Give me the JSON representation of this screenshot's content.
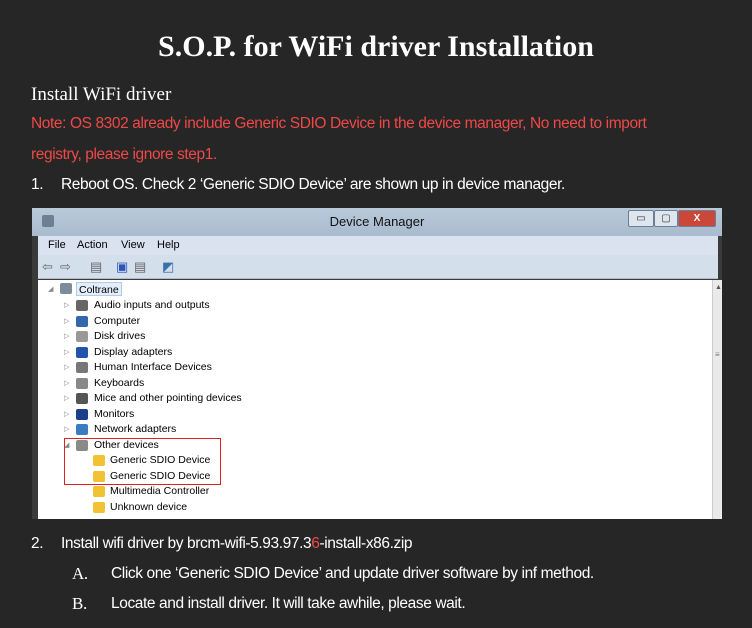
{
  "title": "S.O.P. for WiFi driver Installation",
  "subtitle": "Install WiFi driver",
  "note_line1": "Note: OS 8302 already include Generic SDIO Device in the device manager, No need to import",
  "note_line2": "registry, please ignore step1.",
  "steps": [
    {
      "num": "1.",
      "text": "Reboot OS. Check 2 ‘Generic SDIO Device’ are shown up in device manager."
    },
    {
      "num": "2.",
      "text_pre": "Install wifi driver by brcm-wifi-5.93.97.3",
      "text_red": "6",
      "text_post": "-install-x86.zip",
      "substeps": [
        {
          "letter": "A.",
          "text": "Click one ‘Generic SDIO Device’ and update driver software by inf method."
        },
        {
          "letter": "B.",
          "text": "Locate and install driver. It will take awhile, please wait."
        }
      ]
    }
  ],
  "device_manager": {
    "title": "Device Manager",
    "menu": [
      "File",
      "Action",
      "View",
      "Help"
    ],
    "root": "Coltrane",
    "categories": [
      "Audio inputs and outputs",
      "Computer",
      "Disk drives",
      "Display adapters",
      "Human Interface Devices",
      "Keyboards",
      "Mice and other pointing devices",
      "Monitors",
      "Network adapters",
      "Other devices"
    ],
    "other_devices": [
      "Generic SDIO Device",
      "Generic SDIO Device",
      "Multimedia Controller",
      "Unknown device"
    ]
  },
  "colors": {
    "note": "#f04848",
    "highlight_box": "#e02020",
    "background": "#262626"
  }
}
